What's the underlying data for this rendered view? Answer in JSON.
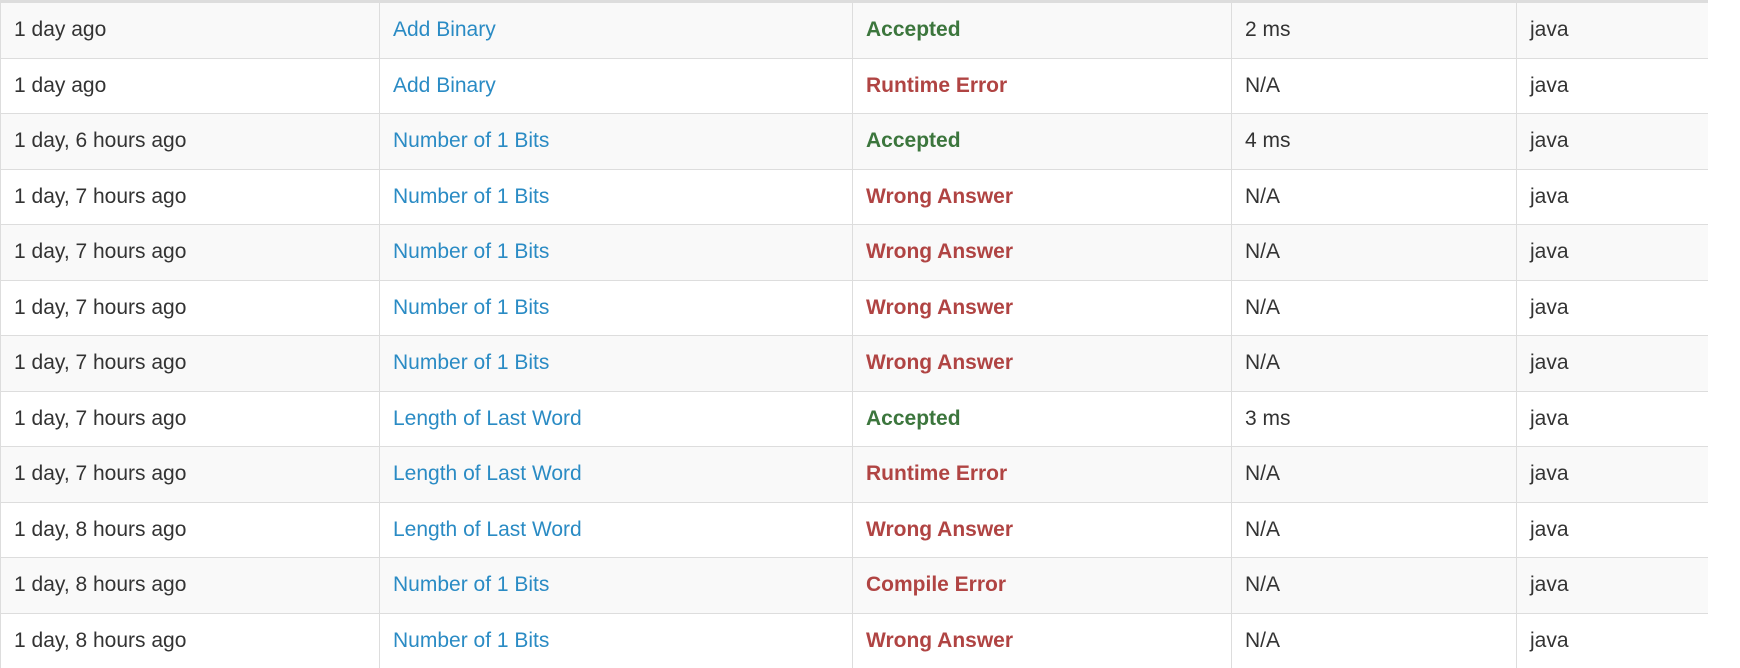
{
  "colors": {
    "link": "#2a8bc4",
    "accepted": "#3c763d",
    "error": "#b04443",
    "text": "#333333",
    "row_stripe": "#f9f9f9",
    "border": "#dddddd"
  },
  "submissions": [
    {
      "time": "1 day ago",
      "question": "Add Binary",
      "status": "Accepted",
      "status_type": "accepted",
      "runtime": "2 ms",
      "language": "java"
    },
    {
      "time": "1 day ago",
      "question": "Add Binary",
      "status": "Runtime Error",
      "status_type": "error",
      "runtime": "N/A",
      "language": "java"
    },
    {
      "time": "1 day, 6 hours ago",
      "question": "Number of 1 Bits",
      "status": "Accepted",
      "status_type": "accepted",
      "runtime": "4 ms",
      "language": "java"
    },
    {
      "time": "1 day, 7 hours ago",
      "question": "Number of 1 Bits",
      "status": "Wrong Answer",
      "status_type": "error",
      "runtime": "N/A",
      "language": "java"
    },
    {
      "time": "1 day, 7 hours ago",
      "question": "Number of 1 Bits",
      "status": "Wrong Answer",
      "status_type": "error",
      "runtime": "N/A",
      "language": "java"
    },
    {
      "time": "1 day, 7 hours ago",
      "question": "Number of 1 Bits",
      "status": "Wrong Answer",
      "status_type": "error",
      "runtime": "N/A",
      "language": "java"
    },
    {
      "time": "1 day, 7 hours ago",
      "question": "Number of 1 Bits",
      "status": "Wrong Answer",
      "status_type": "error",
      "runtime": "N/A",
      "language": "java"
    },
    {
      "time": "1 day, 7 hours ago",
      "question": "Length of Last Word",
      "status": "Accepted",
      "status_type": "accepted",
      "runtime": "3 ms",
      "language": "java"
    },
    {
      "time": "1 day, 7 hours ago",
      "question": "Length of Last Word",
      "status": "Runtime Error",
      "status_type": "error",
      "runtime": "N/A",
      "language": "java"
    },
    {
      "time": "1 day, 8 hours ago",
      "question": "Length of Last Word",
      "status": "Wrong Answer",
      "status_type": "error",
      "runtime": "N/A",
      "language": "java"
    },
    {
      "time": "1 day, 8 hours ago",
      "question": "Number of 1 Bits",
      "status": "Compile Error",
      "status_type": "error",
      "runtime": "N/A",
      "language": "java"
    },
    {
      "time": "1 day, 8 hours ago",
      "question": "Number of 1 Bits",
      "status": "Wrong Answer",
      "status_type": "error",
      "runtime": "N/A",
      "language": "java"
    }
  ]
}
